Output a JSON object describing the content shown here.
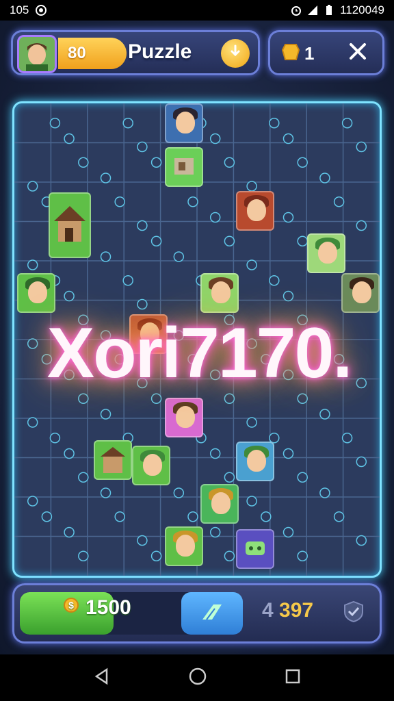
{
  "status": {
    "time": "105",
    "clock": "12:0049",
    "clock_display": "1120049"
  },
  "header": {
    "coins": "80",
    "title": "Puzzle",
    "gems": "1"
  },
  "board": {
    "overlay_text": "Xori7170."
  },
  "bottom": {
    "score": "1500",
    "moves_a": "4",
    "moves_b": "397",
    "progress": 0.42
  },
  "colors": {
    "board_glow": "#7fe3ff",
    "overlay_glow": "#ff4fd0",
    "coin": "#f0a01c",
    "progress": "#3aa02d"
  },
  "icons": [
    "whatsapp-icon",
    "alarm-icon",
    "signal-icon",
    "battery-icon",
    "hint-icon",
    "gem-icon",
    "close-icon",
    "coin-icon",
    "boost-icon",
    "check-icon",
    "back-icon",
    "home-icon",
    "recents-icon"
  ]
}
